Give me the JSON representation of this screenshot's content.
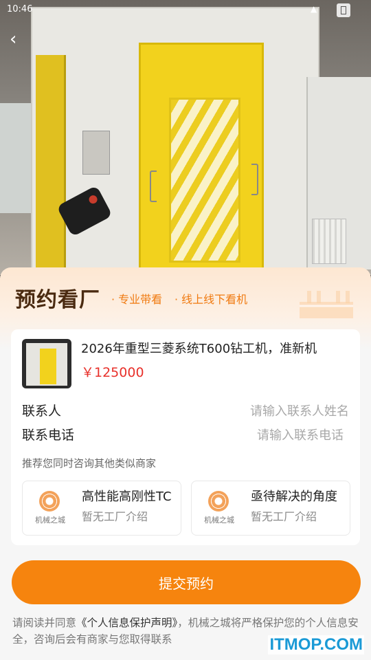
{
  "status_bar": {
    "time": "10:46"
  },
  "hero": {
    "back_icon": "chevron-left-icon"
  },
  "sheet": {
    "title": "预约看厂",
    "tags": [
      "· 专业带看",
      "· 线上线下看机"
    ]
  },
  "product": {
    "title": "2026年重型三菱系统T600钻工机，准新机",
    "price": "￥125000"
  },
  "form": {
    "contact_label": "联系人",
    "contact_placeholder": "请输入联系人姓名",
    "phone_label": "联系电话",
    "phone_placeholder": "请输入联系电话"
  },
  "recommend": {
    "label": "推荐您同时咨询其他类似商家",
    "merchants": [
      {
        "name": "高性能高刚性TC",
        "desc": "暂无工厂介绍",
        "logo_text": "机械之城"
      },
      {
        "name": "亟待解决的角度",
        "desc": "暂无工厂介绍",
        "logo_text": "机械之城"
      }
    ]
  },
  "submit_label": "提交预约",
  "agreement": {
    "prefix": "请阅读并同意",
    "link": "《个人信息保护声明》",
    "suffix": "，机械之城将严格保护您的个人信息安全，咨询后会有商家与您取得联系"
  },
  "watermark": "ITMOP.COM",
  "colors": {
    "accent": "#f6840e",
    "price": "#e8302a",
    "title": "#4a2a10"
  }
}
